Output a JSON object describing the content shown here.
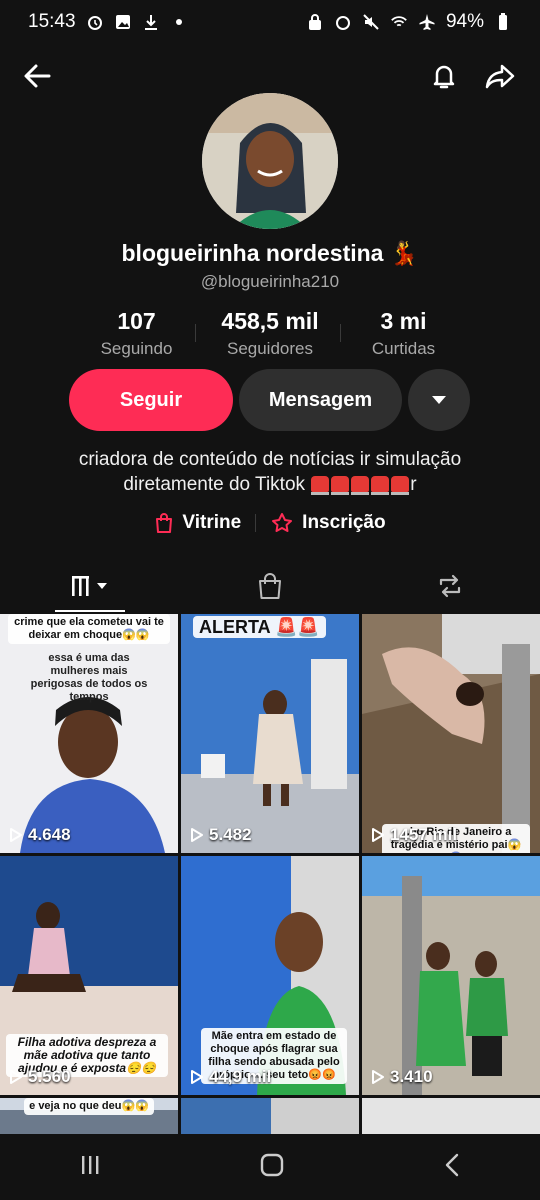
{
  "status_bar": {
    "time": "15:43",
    "battery": "94%"
  },
  "profile": {
    "name": "blogueirinha nordestina 💃",
    "handle": "@blogueirinha210",
    "stats": [
      {
        "value": "107",
        "label": "Seguindo"
      },
      {
        "value": "458,5 mil",
        "label": "Seguidores"
      },
      {
        "value": "3 mi",
        "label": "Curtidas"
      }
    ],
    "follow_label": "Seguir",
    "message_label": "Mensagem",
    "bio_line1": "criadora de conteúdo de notícias ir simulação",
    "bio_line2": "diretamente do Tiktok",
    "bio_end": "r",
    "links": {
      "showcase": "Vitrine",
      "subscription": "Inscrição"
    }
  },
  "videos": [
    {
      "views": "4.648",
      "caption_top": "crime que ela cometeu vai te deixar em choque😱😱",
      "caption_mid": "essa é uma das mulheres mais perigosas de todos os tempos"
    },
    {
      "views": "5.482",
      "caption_top": "ALERTA 🚨🚨"
    },
    {
      "views": "1457 mil",
      "caption_bottom": "...ho Rio de Janeiro a tragédia e mistério pai😱😱"
    },
    {
      "views": "5.560",
      "caption_bottom": "Filha adotiva despreza a mãe adotiva que tanto ajudou e é exposta😔😔"
    },
    {
      "views": "44,9 mil",
      "caption_bottom": "Mãe entra em estado de choque após flagrar sua filha sendo abusada pelo próprio ... seu teto😡😡"
    },
    {
      "views": "3.410"
    },
    {
      "caption_top": "e veja no que deu😱😱"
    }
  ],
  "colors": {
    "accent": "#fe2c55",
    "background": "#121212",
    "secondary_button": "#2f2f2f"
  }
}
